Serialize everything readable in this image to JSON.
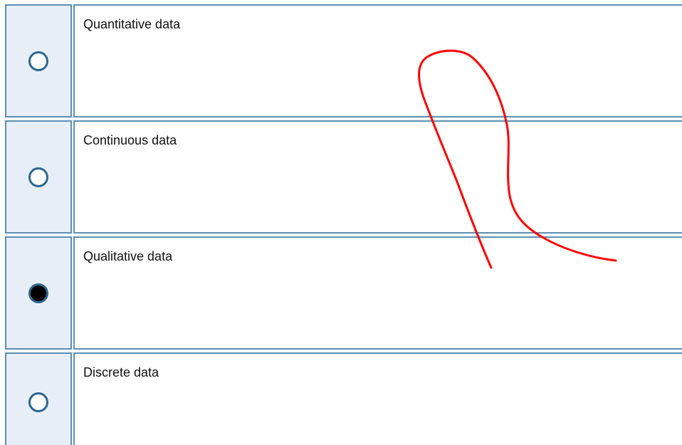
{
  "question": {
    "options": [
      {
        "label": "Quantitative data",
        "selected": false
      },
      {
        "label": "Continuous data",
        "selected": false
      },
      {
        "label": "Qualitative data",
        "selected": true
      },
      {
        "label": "Discrete data",
        "selected": false
      }
    ]
  },
  "colors": {
    "border": "#5b8fb5",
    "radio_cell_bg": "#e8eef8",
    "radio_ring": "#2a6790",
    "radio_fill_selected": "#000000",
    "annotation_stroke": "#ff0000"
  }
}
